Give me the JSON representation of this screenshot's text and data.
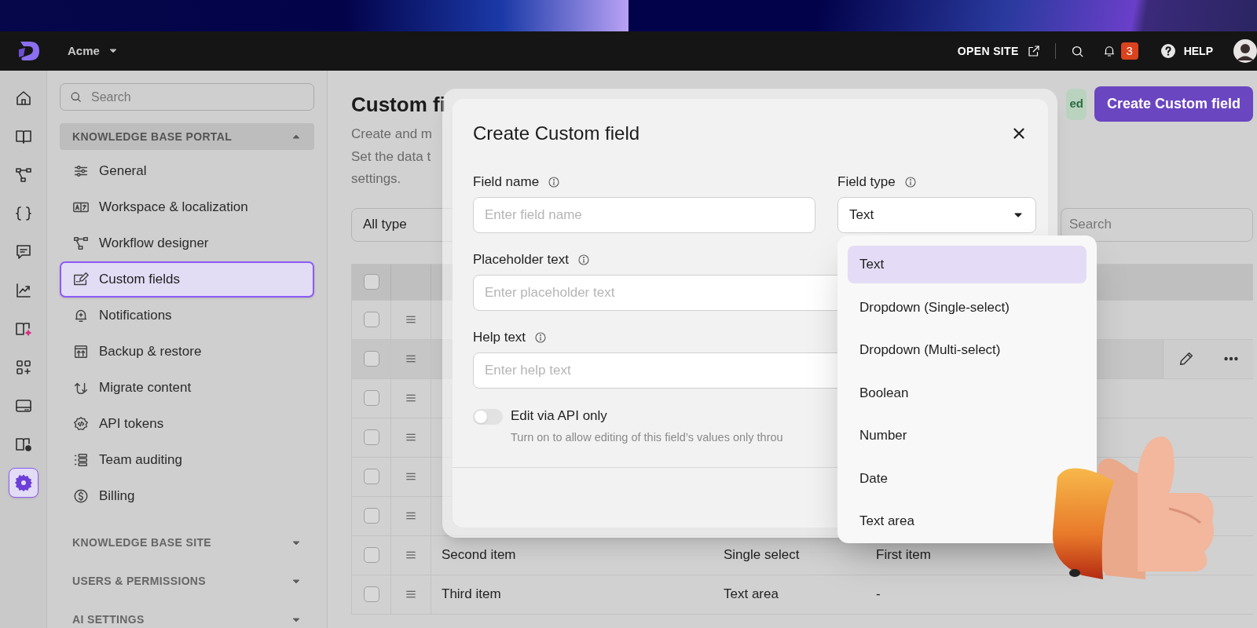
{
  "topbar": {
    "workspace": "Acme",
    "open_site": "OPEN SITE",
    "notification_count": "3",
    "help": "HELP"
  },
  "rail": [
    {
      "selected": false
    },
    {
      "selected": false
    },
    {
      "selected": false
    },
    {
      "selected": false
    },
    {
      "selected": false
    },
    {
      "selected": false
    },
    {
      "selected": false
    },
    {
      "selected": false
    },
    {
      "selected": false
    },
    {
      "selected": false
    },
    {
      "selected": true
    }
  ],
  "sidebar": {
    "search_placeholder": "Search",
    "sections": [
      {
        "title": "KNOWLEDGE BASE PORTAL",
        "expanded": true,
        "items": [
          {
            "label": "General",
            "selected": false
          },
          {
            "label": "Workspace & localization",
            "selected": false
          },
          {
            "label": "Workflow designer",
            "selected": false
          },
          {
            "label": "Custom fields",
            "selected": true
          },
          {
            "label": "Notifications",
            "selected": false
          },
          {
            "label": "Backup & restore",
            "selected": false
          },
          {
            "label": "Migrate content",
            "selected": false
          },
          {
            "label": "API tokens",
            "selected": false
          },
          {
            "label": "Team auditing",
            "selected": false
          },
          {
            "label": "Billing",
            "selected": false
          }
        ]
      },
      {
        "title": "KNOWLEDGE BASE SITE",
        "expanded": false
      },
      {
        "title": "USERS & PERMISSIONS",
        "expanded": false
      },
      {
        "title": "AI SETTINGS",
        "expanded": false
      }
    ]
  },
  "page": {
    "title": "Custom fi",
    "description": [
      "Create and m",
      "Set the data t",
      "settings."
    ],
    "badge": "ed",
    "create_button": "Create Custom field",
    "filter": "All type",
    "search_placeholder": "Search"
  },
  "table": {
    "all_checked": false,
    "rows": [
      {
        "hovered": false,
        "checked": false
      },
      {
        "hovered": true,
        "checked": false
      },
      {
        "hovered": false,
        "checked": false
      },
      {
        "hovered": false,
        "checked": false
      },
      {
        "hovered": false,
        "checked": false
      },
      {
        "hovered": false,
        "checked": false
      },
      {
        "hovered": false,
        "checked": false,
        "cells": [
          "Second item",
          "Single select",
          "First item"
        ]
      },
      {
        "hovered": false,
        "checked": false,
        "cells": [
          "Third item",
          "Text area",
          "-"
        ]
      }
    ]
  },
  "modal": {
    "title": "Create Custom field",
    "field_name": {
      "label": "Field name",
      "placeholder": "Enter field name"
    },
    "field_type": {
      "label": "Field type",
      "value": "Text"
    },
    "placeholder_text": {
      "label": "Placeholder text",
      "placeholder": "Enter placeholder text"
    },
    "help_text": {
      "label": "Help text",
      "placeholder": "Enter help text"
    },
    "api_only": {
      "label": "Edit via API only",
      "on": false,
      "description": "Turn on to allow editing of this field’s values only throu"
    }
  },
  "field_type_options": [
    {
      "label": "Text",
      "selected": true
    },
    {
      "label": "Dropdown (Single-select)",
      "selected": false
    },
    {
      "label": "Dropdown (Multi-select)",
      "selected": false
    },
    {
      "label": "Boolean",
      "selected": false
    },
    {
      "label": "Number",
      "selected": false
    },
    {
      "label": "Date",
      "selected": false
    },
    {
      "label": "Text area",
      "selected": false
    }
  ]
}
